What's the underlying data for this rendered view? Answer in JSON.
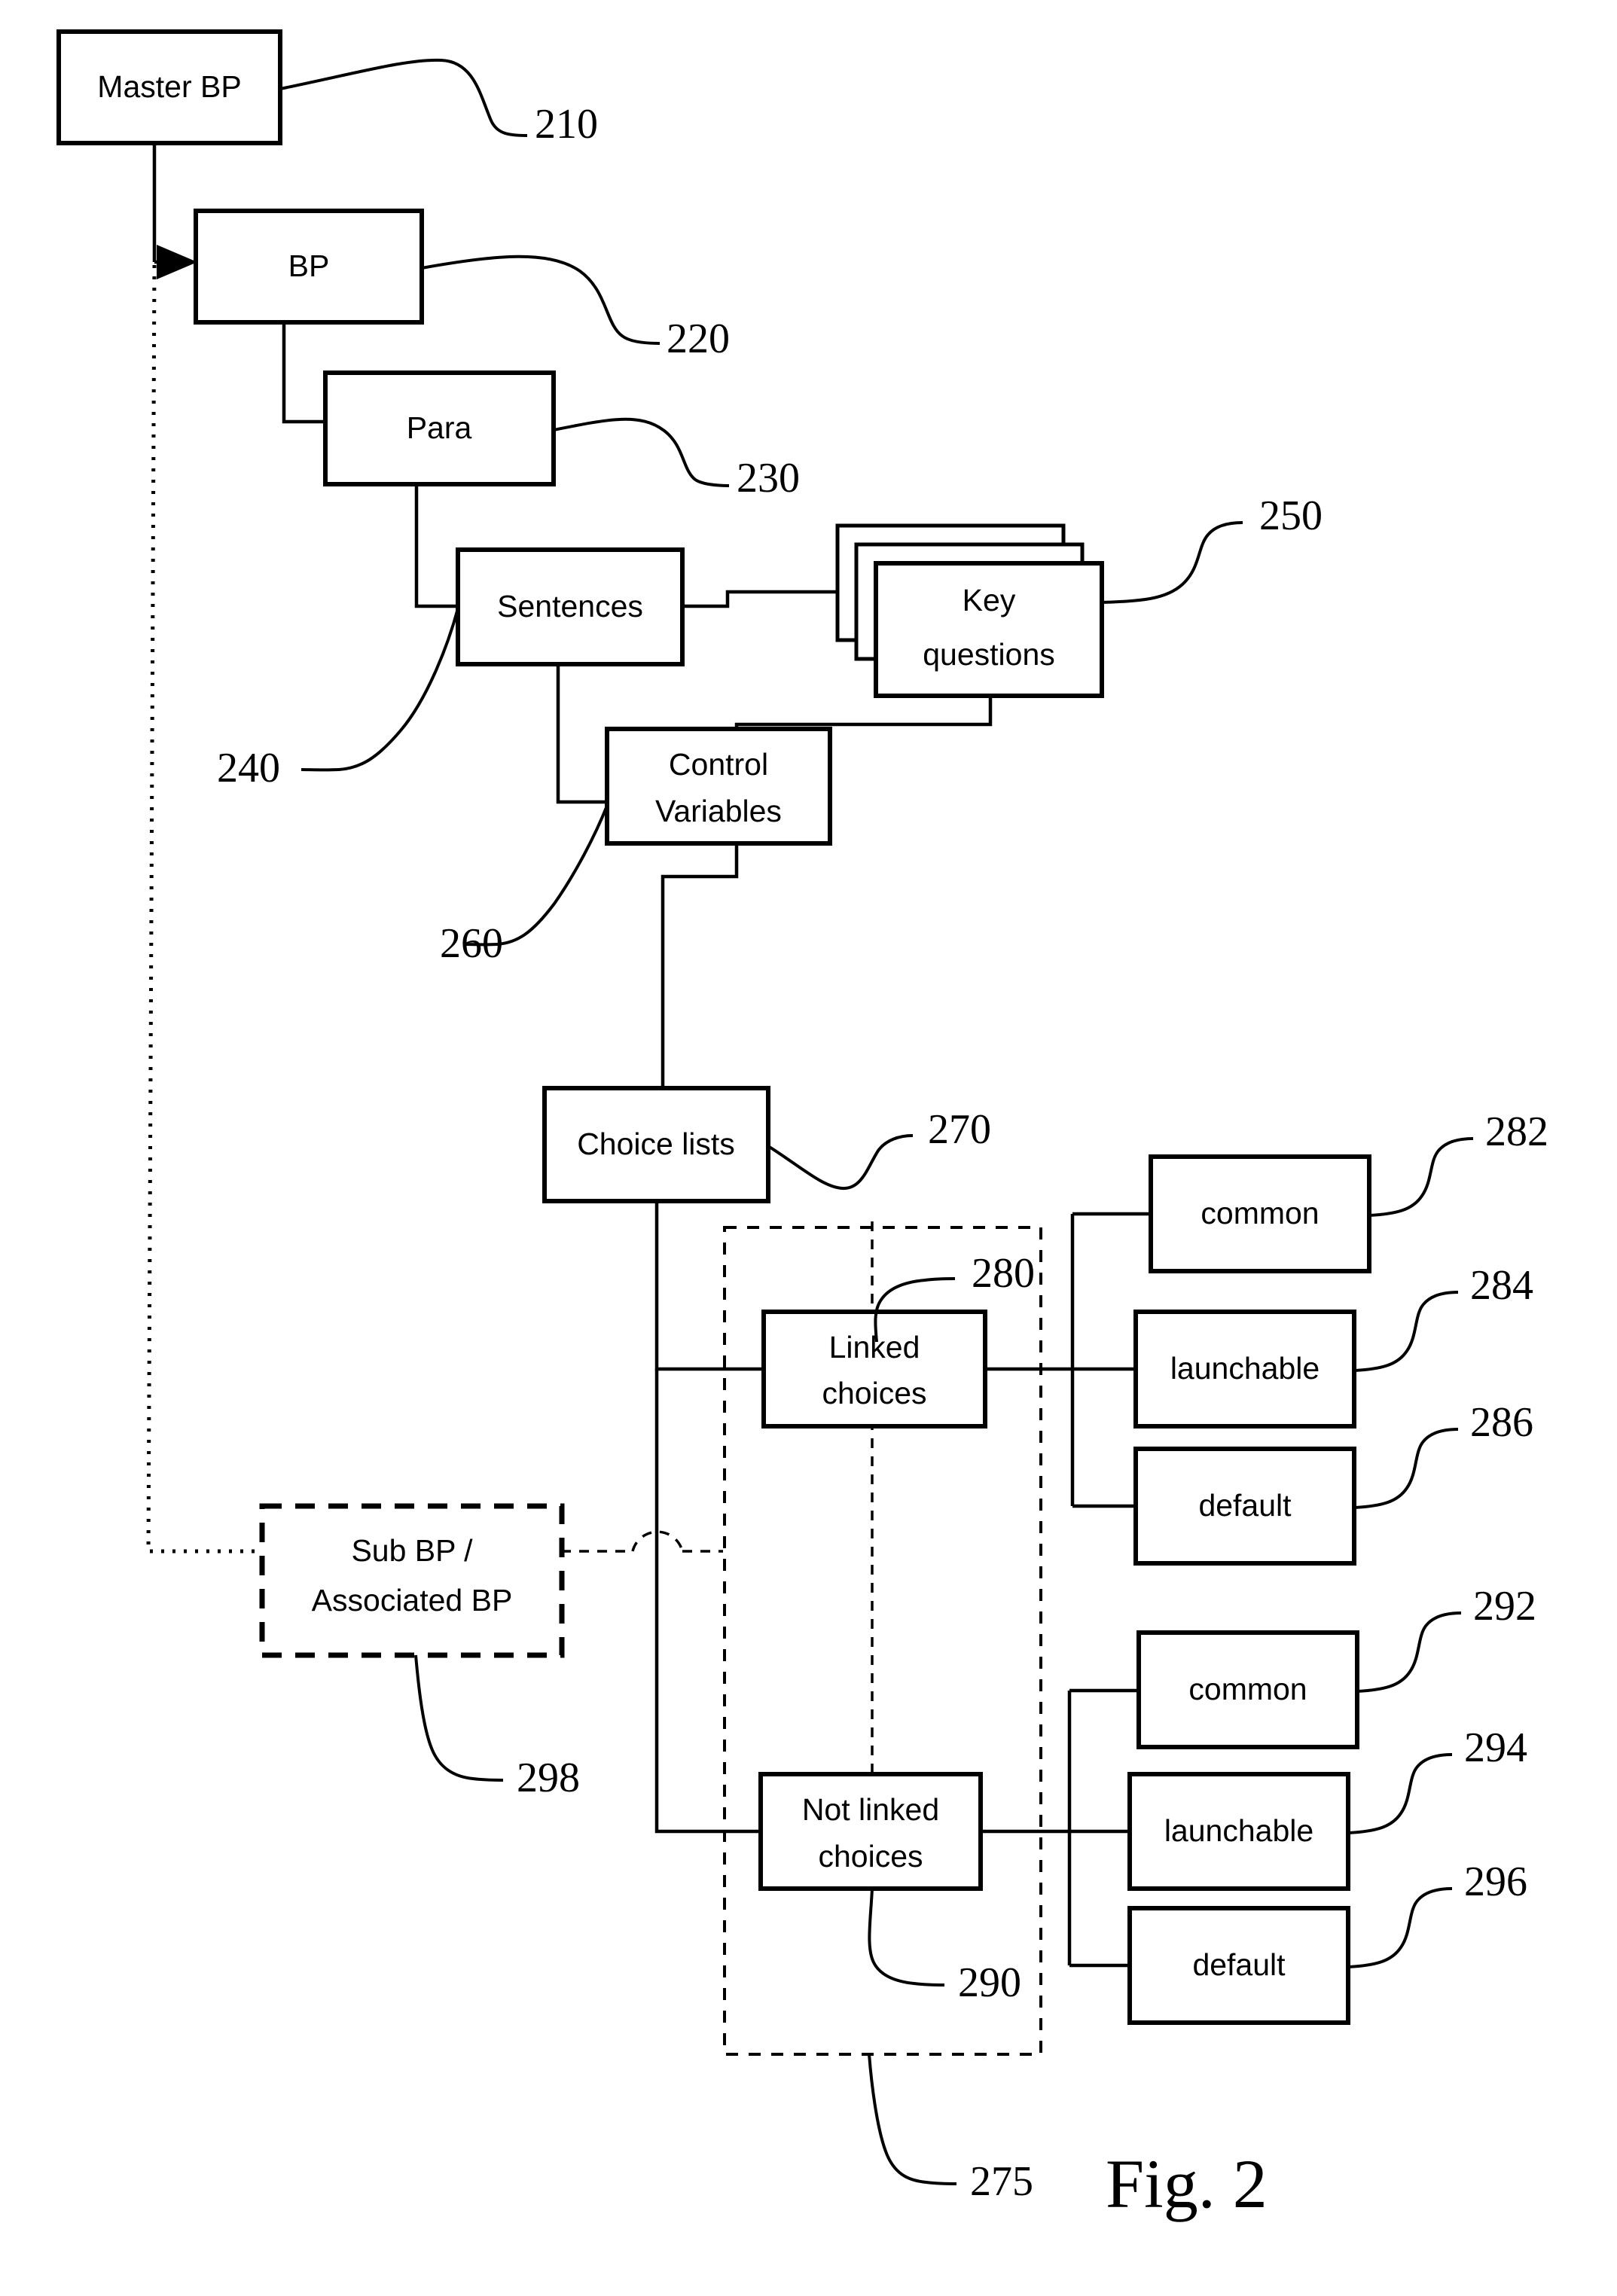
{
  "figure": {
    "caption": "Fig. 2",
    "title": "Business process hierarchy diagram"
  },
  "nodes": {
    "master_bp": {
      "label": "Master BP",
      "ref": "210"
    },
    "bp": {
      "label": "BP",
      "ref": "220"
    },
    "para": {
      "label": "Para",
      "ref": "230"
    },
    "sentences": {
      "label": "Sentences",
      "ref": "240"
    },
    "key_questions": {
      "label_line1": "Key",
      "label_line2": "questions",
      "ref": "250"
    },
    "control_variables": {
      "label_line1": "Control",
      "label_line2": "Variables",
      "ref": "260"
    },
    "choice_lists": {
      "label": "Choice lists",
      "ref": "270"
    },
    "linked_choices": {
      "label_line1": "Linked",
      "label_line2": "choices",
      "ref": "280"
    },
    "linked_common": {
      "label": "common",
      "ref": "282"
    },
    "linked_launchable": {
      "label": "launchable",
      "ref": "284"
    },
    "linked_default": {
      "label": "default",
      "ref": "286"
    },
    "not_linked_choices": {
      "label_line1": "Not linked",
      "label_line2": "choices",
      "ref": "290"
    },
    "not_linked_common": {
      "label": "common",
      "ref": "292"
    },
    "not_linked_launchable": {
      "label": "launchable",
      "ref": "294"
    },
    "not_linked_default": {
      "label": "default",
      "ref": "296"
    },
    "choices_group": {
      "ref": "275"
    },
    "sub_bp": {
      "label_line1": "Sub BP /",
      "label_line2": "Associated BP",
      "ref": "298"
    }
  },
  "colors": {
    "line": "#000000",
    "background": "#ffffff",
    "text": "#000000"
  }
}
